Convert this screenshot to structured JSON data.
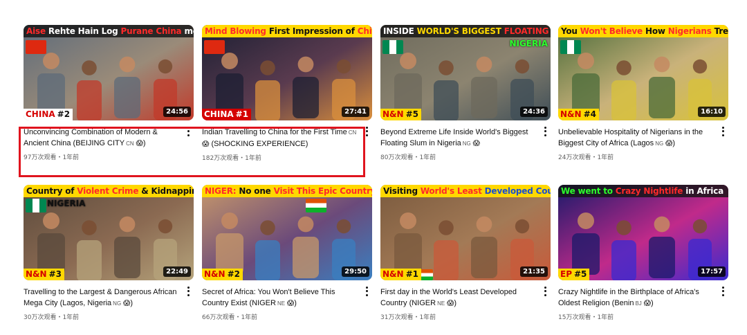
{
  "videos": [
    {
      "banner": [
        {
          "t": "Aise",
          "c": "#ff2a2a"
        },
        {
          "t": "Rehte Hain Log",
          "c": "#ffffff"
        },
        {
          "t": "Purane China",
          "c": "#ff2a2a"
        },
        {
          "t": "me",
          "c": "#ffffff"
        }
      ],
      "banner_style": "dark",
      "tag": "CHINA",
      "tag_num": "#2",
      "tag_style": "white",
      "duration": "24:56",
      "title_main": "Unconvincing Combination of Modern & Ancient China (BEIJING CITY",
      "title_cc": "CN",
      "title_end": ")",
      "stats": "97万次观看・1年前",
      "palette": [
        "#5d6b7a",
        "#9a8b79",
        "#c23a2a"
      ]
    },
    {
      "banner": [
        {
          "t": "Mind Blowing",
          "c": "#ff2a2a"
        },
        {
          "t": "First Impression of",
          "c": "#111111"
        },
        {
          "t": "China",
          "c": "#ff2a2a"
        }
      ],
      "banner_style": "yellow",
      "tag": "CHINA",
      "tag_num": "#1",
      "tag_style": "red",
      "duration": "27:41",
      "title_main": "Indian Travelling to China for the First Time",
      "title_cc": "CN",
      "title_end": "(SHOCKING EXPERIENCE)",
      "stats": "182万次观看・1年前",
      "palette": [
        "#1c1f33",
        "#5a3b4f",
        "#d98f3c"
      ]
    },
    {
      "banner": [
        {
          "t": "INSIDE",
          "c": "#ffffff"
        },
        {
          "t": "WORLD'S BIGGEST",
          "c": "#ffd800"
        },
        {
          "t": "FLOATING SLUM",
          "c": "#ff2a2a"
        }
      ],
      "banner_style": "dark",
      "sub_label": "NIGERIA",
      "tag": "N&N",
      "tag_num": "#5",
      "tag_style": "yellow",
      "duration": "24:36",
      "title_main": "Beyond Extreme Life Inside World's Biggest Floating Slum in Nigeria",
      "title_cc": "NG",
      "title_end": "",
      "stats": "80万次观看・1年前",
      "palette": [
        "#6d6a5c",
        "#8c8470",
        "#3f4e57"
      ]
    },
    {
      "banner": [
        {
          "t": "You",
          "c": "#111111"
        },
        {
          "t": "Won't Believe",
          "c": "#ff2a2a"
        },
        {
          "t": "How",
          "c": "#111111"
        },
        {
          "t": "Nigerians",
          "c": "#ff2a2a"
        },
        {
          "t": "Treated Me",
          "c": "#111111"
        }
      ],
      "banner_style": "yellow",
      "tag": "N&N",
      "tag_num": "#4",
      "tag_style": "yellow",
      "duration": "16:10",
      "title_main": "Unbelievable Hospitality of Nigerians in the Biggest City of Africa (Lagos",
      "title_cc": "NG",
      "title_end": ")",
      "stats": "24万次观看・1年前",
      "palette": [
        "#4a6b3a",
        "#c9b27a",
        "#d8c23a"
      ]
    },
    {
      "banner": [
        {
          "t": "Country of",
          "c": "#111111"
        },
        {
          "t": "Violent Crime",
          "c": "#ff2a2a"
        },
        {
          "t": "& Kidnapping",
          "c": "#111111"
        }
      ],
      "banner_style": "yellow",
      "sub_label": "NIGERIA",
      "tag": "N&N",
      "tag_num": "#3",
      "tag_style": "yellow",
      "duration": "22:49",
      "title_main": "Travelling to the Largest & Dangerous African Mega City (Lagos, Nigeria",
      "title_cc": "NG",
      "title_end": ")",
      "stats": "30万次观看・1年前",
      "palette": [
        "#5a4a3c",
        "#8b6a52",
        "#b5a37b"
      ]
    },
    {
      "banner": [
        {
          "t": "NIGER:",
          "c": "#ff2a2a"
        },
        {
          "t": "No one",
          "c": "#111111"
        },
        {
          "t": "Visit This",
          "c": "#ff2a2a"
        },
        {
          "t": "Epic Country",
          "c": "#ff2a2a"
        }
      ],
      "banner_style": "yellow",
      "tag": "N&N",
      "tag_num": "#2",
      "tag_style": "yellow",
      "duration": "29:50",
      "title_main": "Secret of Africa: You Won't Believe This Country Exist (NIGER",
      "title_cc": "NE",
      "title_end": ")",
      "stats": "66万次观看・1年前",
      "palette": [
        "#c7986a",
        "#6b4a7a",
        "#3a7fc0"
      ]
    },
    {
      "banner": [
        {
          "t": "Visiting",
          "c": "#111111"
        },
        {
          "t": "World's Least",
          "c": "#ff2a2a"
        },
        {
          "t": "Developed Country",
          "c": "#1a4fd0"
        }
      ],
      "banner_style": "yellow",
      "tag": "N&N",
      "tag_num": "#1",
      "tag_style": "yellow",
      "duration": "21:35",
      "title_main": "First day in the World's Least Developed Country (NIGER",
      "title_cc": "NE",
      "title_end": ")",
      "stats": "31万次观看・1年前",
      "palette": [
        "#7a5a3e",
        "#a37a56",
        "#c95a3a"
      ]
    },
    {
      "banner": [
        {
          "t": "We went to",
          "c": "#2dff2d"
        },
        {
          "t": "Crazy Nightlife",
          "c": "#ff2a2a"
        },
        {
          "t": "in Africa",
          "c": "#ffffff"
        }
      ],
      "banner_style": "dark",
      "tag": "EP",
      "tag_num": "#5",
      "tag_style": "yellow",
      "duration": "17:57",
      "title_main": "Crazy Nightlife in the Birthplace of Africa's Oldest Religion (Benin",
      "title_cc": "BJ",
      "title_end": ")",
      "stats": "15万次观看・1年前",
      "palette": [
        "#1a1a6a",
        "#c02a8a",
        "#3a2ad0"
      ]
    }
  ]
}
